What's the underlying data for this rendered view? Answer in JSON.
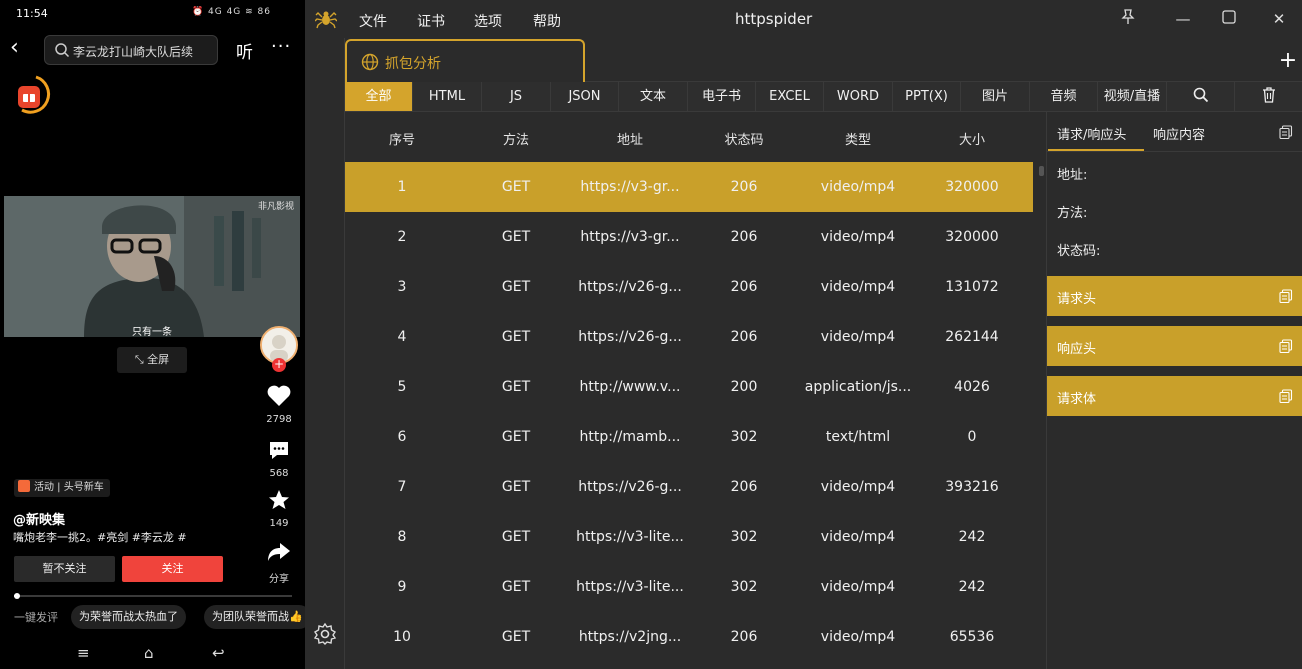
{
  "phone": {
    "status_time": "11:54",
    "status_icons": "⏰ 4G 4G ≋ 86",
    "search_text": "李云龙打山崎大队后续",
    "listen_label": "听",
    "more_label": "···",
    "video_watermark": "非凡影视",
    "video_subtitle": "只有一条",
    "fullscreen_label": "全屏",
    "likes": "2798",
    "comments": "568",
    "favorites": "149",
    "share_label": "分享",
    "tag_text": "活动 | 头号新车",
    "author": "@新映集",
    "description": "嘴炮老李一挑2。#亮剑 #李云龙 #",
    "nofollow_label": "暂不关注",
    "follow_label": "关注",
    "progress": 0.01,
    "comment_prompt": "一键发评",
    "chips": [
      "为荣誉而战太热血了",
      "为团队荣誉而战👍"
    ]
  },
  "app": {
    "title": "httpspider",
    "menu": [
      "文件",
      "证书",
      "选项",
      "帮助"
    ],
    "main_tab": "抓包分析",
    "filters": [
      "全部",
      "HTML",
      "JS",
      "JSON",
      "文本",
      "电子书",
      "EXCEL",
      "WORD",
      "PPT(X)",
      "图片",
      "音频",
      "视频/直播"
    ],
    "active_filter": "全部",
    "columns": [
      "序号",
      "方法",
      "地址",
      "状态码",
      "类型",
      "大小"
    ],
    "rows": [
      {
        "id": "1",
        "method": "GET",
        "url": "https://v3-gr...",
        "status": "206",
        "type": "video/mp4",
        "size": "320000"
      },
      {
        "id": "2",
        "method": "GET",
        "url": "https://v3-gr...",
        "status": "206",
        "type": "video/mp4",
        "size": "320000"
      },
      {
        "id": "3",
        "method": "GET",
        "url": "https://v26-g...",
        "status": "206",
        "type": "video/mp4",
        "size": "131072"
      },
      {
        "id": "4",
        "method": "GET",
        "url": "https://v26-g...",
        "status": "206",
        "type": "video/mp4",
        "size": "262144"
      },
      {
        "id": "5",
        "method": "GET",
        "url": "http://www.v...",
        "status": "200",
        "type": "application/js...",
        "size": "4026"
      },
      {
        "id": "6",
        "method": "GET",
        "url": "http://mamb...",
        "status": "302",
        "type": "text/html",
        "size": "0"
      },
      {
        "id": "7",
        "method": "GET",
        "url": "https://v26-g...",
        "status": "206",
        "type": "video/mp4",
        "size": "393216"
      },
      {
        "id": "8",
        "method": "GET",
        "url": "https://v3-lite...",
        "status": "302",
        "type": "video/mp4",
        "size": "242"
      },
      {
        "id": "9",
        "method": "GET",
        "url": "https://v3-lite...",
        "status": "302",
        "type": "video/mp4",
        "size": "242"
      },
      {
        "id": "10",
        "method": "GET",
        "url": "https://v2jng...",
        "status": "206",
        "type": "video/mp4",
        "size": "65536"
      }
    ],
    "selected_row": "1",
    "detail": {
      "tabs": [
        "请求/响应头",
        "响应内容"
      ],
      "fields": [
        "地址:",
        "方法:",
        "状态码:"
      ],
      "sections": [
        "请求头",
        "响应头",
        "请求体"
      ]
    },
    "colors": {
      "accent": "#d4a42c",
      "background": "#2b2b2b"
    }
  }
}
